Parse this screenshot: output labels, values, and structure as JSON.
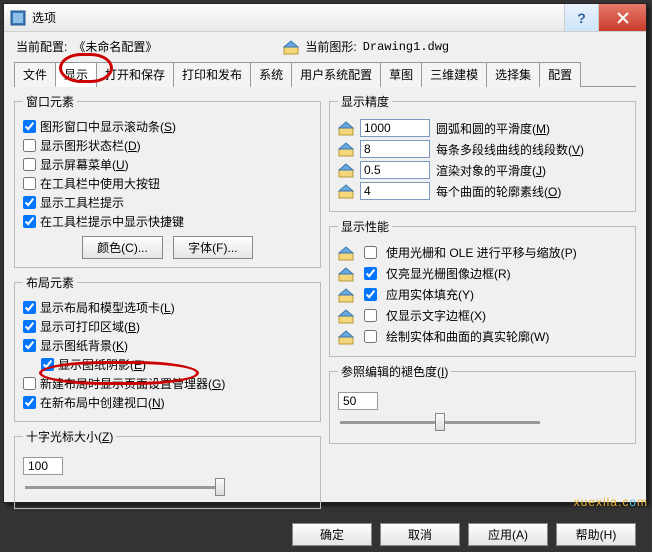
{
  "window": {
    "title": "选项",
    "help": "?",
    "close": "×"
  },
  "top": {
    "current_config_label": "当前配置:",
    "current_config_value": "《未命名配置》",
    "current_drawing_label": "当前图形:",
    "current_drawing_value": "Drawing1.dwg"
  },
  "tabs": [
    "文件",
    "显示",
    "打开和保存",
    "打印和发布",
    "系统",
    "用户系统配置",
    "草图",
    "三维建模",
    "选择集",
    "配置"
  ],
  "active_tab": 1,
  "win_elem": {
    "legend": "窗口元素",
    "items": [
      {
        "label": "图形窗口中显示滚动条(S)",
        "checked": true
      },
      {
        "label": "显示图形状态栏(D)",
        "checked": false
      },
      {
        "label": "显示屏幕菜单(U)",
        "checked": false
      },
      {
        "label": "在工具栏中使用大按钮",
        "checked": false
      },
      {
        "label": "显示工具栏提示",
        "checked": true
      },
      {
        "label": "在工具栏提示中显示快捷键",
        "checked": true,
        "indent": false
      }
    ],
    "color_btn": "颜色(C)...",
    "font_btn": "字体(F)..."
  },
  "layout_elem": {
    "legend": "布局元素",
    "items": [
      {
        "label": "显示布局和模型选项卡(L)",
        "checked": true
      },
      {
        "label": "显示可打印区域(B)",
        "checked": true
      },
      {
        "label": "显示图纸背景(K)",
        "checked": true
      },
      {
        "label": "显示图纸阴影(E)",
        "checked": true,
        "indent": true
      },
      {
        "label": "新建布局时显示页面设置管理器(G)",
        "checked": false
      },
      {
        "label": "在新布局中创建视口(N)",
        "checked": true
      }
    ]
  },
  "crosshair": {
    "legend": "十字光标大小(Z)",
    "value": "100"
  },
  "precision": {
    "legend": "显示精度",
    "rows": [
      {
        "value": "1000",
        "label": "圆弧和圆的平滑度(M)"
      },
      {
        "value": "8",
        "label": "每条多段线曲线的线段数(V)"
      },
      {
        "value": "0.5",
        "label": "渲染对象的平滑度(J)"
      },
      {
        "value": "4",
        "label": "每个曲面的轮廓素线(O)"
      }
    ]
  },
  "performance": {
    "legend": "显示性能",
    "items": [
      {
        "label": "使用光栅和 OLE 进行平移与缩放(P)",
        "checked": false
      },
      {
        "label": "仅亮显光栅图像边框(R)",
        "checked": true
      },
      {
        "label": "应用实体填充(Y)",
        "checked": true
      },
      {
        "label": "仅显示文字边框(X)",
        "checked": false
      },
      {
        "label": "绘制实体和曲面的真实轮廓(W)",
        "checked": false
      }
    ]
  },
  "fade": {
    "legend": "参照编辑的褪色度(I)",
    "value": "50"
  },
  "buttons": {
    "ok": "确定",
    "cancel": "取消",
    "apply": "应用(A)",
    "help": "帮助(H)"
  },
  "watermark_a": "xuexila.c",
  "watermark_b": "o",
  "watermark_c": "m"
}
